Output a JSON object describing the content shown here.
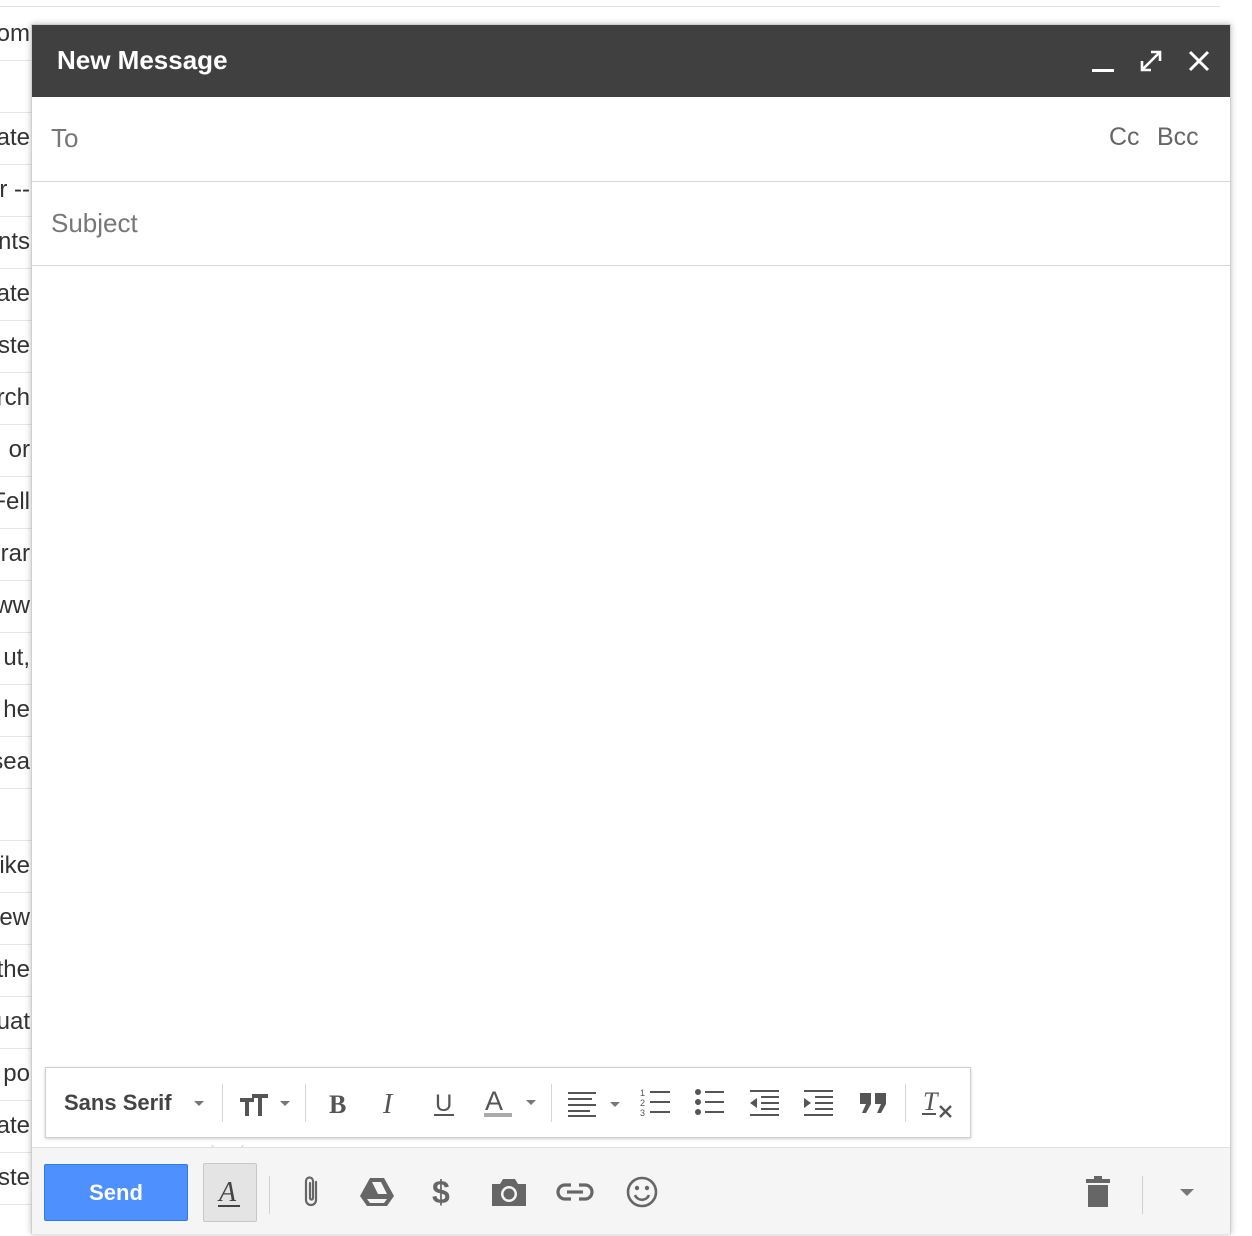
{
  "background": {
    "fragments": [
      "om",
      "",
      "ate",
      "r --",
      "nts",
      "eate",
      "ste",
      "rch",
      "or",
      "Fell",
      "urar",
      "www",
      "ut,",
      "he",
      "sea",
      "",
      "like",
      "ew",
      "the",
      "uat",
      "po",
      "ate",
      "ste"
    ]
  },
  "compose": {
    "title": "New Message",
    "to_label": "To",
    "cc_label": "Cc",
    "bcc_label": "Bcc",
    "subject_label": "Subject",
    "to_value": "",
    "subject_value": "",
    "body_value": ""
  },
  "toolbar": {
    "font_family": "Sans Serif",
    "send_label": "Send",
    "icons": [
      "font-size-icon",
      "bold-icon",
      "italic-icon",
      "underline-icon",
      "text-color-icon",
      "align-icon",
      "numbered-list-icon",
      "bulleted-list-icon",
      "indent-less-icon",
      "indent-more-icon",
      "quote-icon",
      "remove-formatting-icon",
      "formatting-options-icon",
      "attach-icon",
      "drive-icon",
      "money-icon",
      "photo-icon",
      "link-icon",
      "emoji-icon",
      "trash-icon",
      "more-options-icon"
    ]
  },
  "colors": {
    "titlebar": "#404040",
    "send": "#4d90fe",
    "icon": "#666666"
  }
}
